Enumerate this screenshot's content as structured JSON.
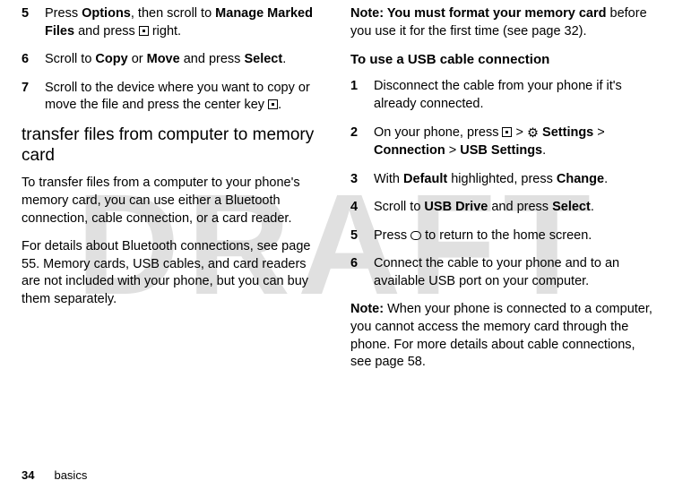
{
  "watermark": "DRAFT",
  "left": {
    "steps_a": [
      {
        "num": "5",
        "pre": "Press ",
        "b1": "Options",
        "mid1": ", then scroll to ",
        "b2": "Manage Marked Files",
        "mid2": " and press ",
        "sym": "nav",
        "post": " right."
      },
      {
        "num": "6",
        "pre": "Scroll to ",
        "b1": "Copy",
        "mid1": " or ",
        "b2": "Move",
        "mid2": " and press ",
        "b3": "Select",
        "post": "."
      },
      {
        "num": "7",
        "pre": "Scroll to the device where you want to copy or move the file and press the center key ",
        "sym": "nav",
        "post": "."
      }
    ],
    "heading": "transfer files from computer to memory card",
    "para1": "To transfer files from a computer to your phone's memory card, you can use either a Bluetooth connection, cable connection, or a card reader.",
    "para2": "For details about Bluetooth connections, see page 55. Memory cards, USB cables, and card readers are not included with your phone, but you can buy them separately."
  },
  "right": {
    "note1_b": "Note: You must format your memory card",
    "note1_rest": " before you use it for the first time (see page 32).",
    "heading": "To use a USB cable connection",
    "steps": [
      {
        "num": "1",
        "text": "Disconnect the cable from your phone if it's already connected."
      },
      {
        "num": "2",
        "pre": "On your phone, press ",
        "sym1": "nav",
        "gt1": " > ",
        "sym2": "gear",
        "sp": " ",
        "b1": "Settings",
        "gt2": " >",
        "b2": "Connection",
        "gt3": " > ",
        "b3": "USB Settings",
        "post": "."
      },
      {
        "num": "3",
        "pre": "With ",
        "b1": "Default",
        "mid": " highlighted, press ",
        "b2": "Change",
        "post": "."
      },
      {
        "num": "4",
        "pre": "Scroll to ",
        "b1": "USB Drive",
        "mid": " and press ",
        "b2": "Select",
        "post": "."
      },
      {
        "num": "5",
        "pre": "Press ",
        "sym": "home",
        "post": " to return to the home screen."
      },
      {
        "num": "6",
        "text": "Connect the cable to your phone and to an available USB port on your computer."
      }
    ],
    "note2_b": "Note:",
    "note2_rest": " When your phone is connected to a computer, you cannot access the memory card through the phone. For more details about cable connections, see page 58."
  },
  "footer": {
    "page": "34",
    "section": "basics"
  }
}
